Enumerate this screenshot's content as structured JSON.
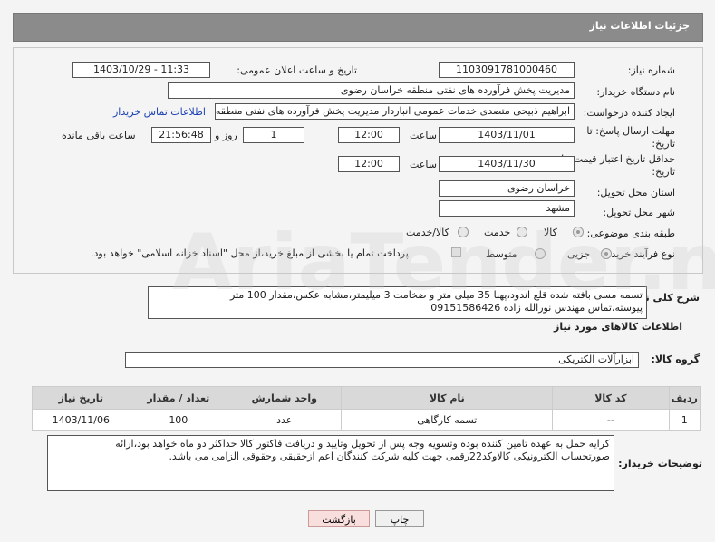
{
  "header": {
    "title": "جزئیات اطلاعات نیاز"
  },
  "fields": {
    "need_number_label": "شماره نیاز:",
    "need_number": "1103091781000460",
    "announce_label": "تاریخ و ساعت اعلان عمومی:",
    "announce_value": "1403/10/29 - 11:33",
    "buyer_org_label": "نام دستگاه خریدار:",
    "buyer_org": "مدیریت پخش فرآورده های نفتی منطقه خراسان رضوی",
    "requester_label": "ایجاد کننده درخواست:",
    "requester": "ابراهیم ذبیحی متصدی خدمات عمومی انباردار مدیریت پخش فرآورده های نفتی منطقه",
    "contact_link": "اطلاعات تماس خریدار",
    "deadline_label_1": "مهلت ارسال پاسخ: تا",
    "deadline_label_2": "تاریخ:",
    "deadline_date": "1403/11/01",
    "time_label": "ساعت",
    "deadline_time": "12:00",
    "days_value": "1",
    "days_label": "روز و",
    "remaining_time": "21:56:48",
    "remaining_label": "ساعت باقی مانده",
    "validity_label_1": "حداقل تاریخ اعتبار قیمت: تا",
    "validity_label_2": "تاریخ:",
    "validity_date": "1403/11/30",
    "validity_time": "12:00",
    "province_label": "استان محل تحویل:",
    "province": "خراسان رضوی",
    "city_label": "شهر محل تحویل:",
    "city": "مشهد",
    "category_label": "طبقه بندی موضوعی:",
    "category_options": [
      "کالا",
      "خدمت",
      "کالا/خدمت"
    ],
    "process_label": "نوع فرآیند خرید :",
    "process_options": [
      "جزیی",
      "متوسط"
    ],
    "payment_note": "پرداخت تمام یا بخشی از مبلغ خرید،از محل \"اسناد خزانه اسلامی\" خواهد بود."
  },
  "summary": {
    "label": "شرح کلی نیاز:",
    "text_line1": "تسمه مسی بافته شده قلع اندود،پهنا 35 میلی متر و ضخامت 3 میلیمتر،مشابه عکس،مقدار 100 متر",
    "text_line2": "پیوسته،تماس مهندس نورالله زاده 09151586426"
  },
  "goods_section": {
    "title": "اطلاعات کالاهای مورد نیاز",
    "group_label": "گروه کالا:",
    "group_value": "ابزارآلات الکتریکی"
  },
  "table": {
    "headers": [
      "ردیف",
      "کد کالا",
      "نام کالا",
      "واحد شمارش",
      "تعداد / مقدار",
      "تاریخ نیاز"
    ],
    "rows": [
      [
        "1",
        "--",
        "تسمه کارگاهی",
        "عدد",
        "100",
        "1403/11/06"
      ]
    ]
  },
  "buyer_notes": {
    "label": "توضیحات خریدار:",
    "line1": "کرایه حمل به عهده تامین کننده بوده وتسویه وجه پس از تحویل وتایید و دریافت فاکتور کالا حداکثر دو ماه خواهد بود،ارائه",
    "line2": "صورتحساب الکترونیکی کالاوکد22رقمی جهت کلیه شرکت کنندگان اعم ازحقیقی وحقوقی الزامی می باشد."
  },
  "buttons": {
    "print": "چاپ",
    "back": "بازگشت"
  },
  "watermark": "AriaTender.neT"
}
